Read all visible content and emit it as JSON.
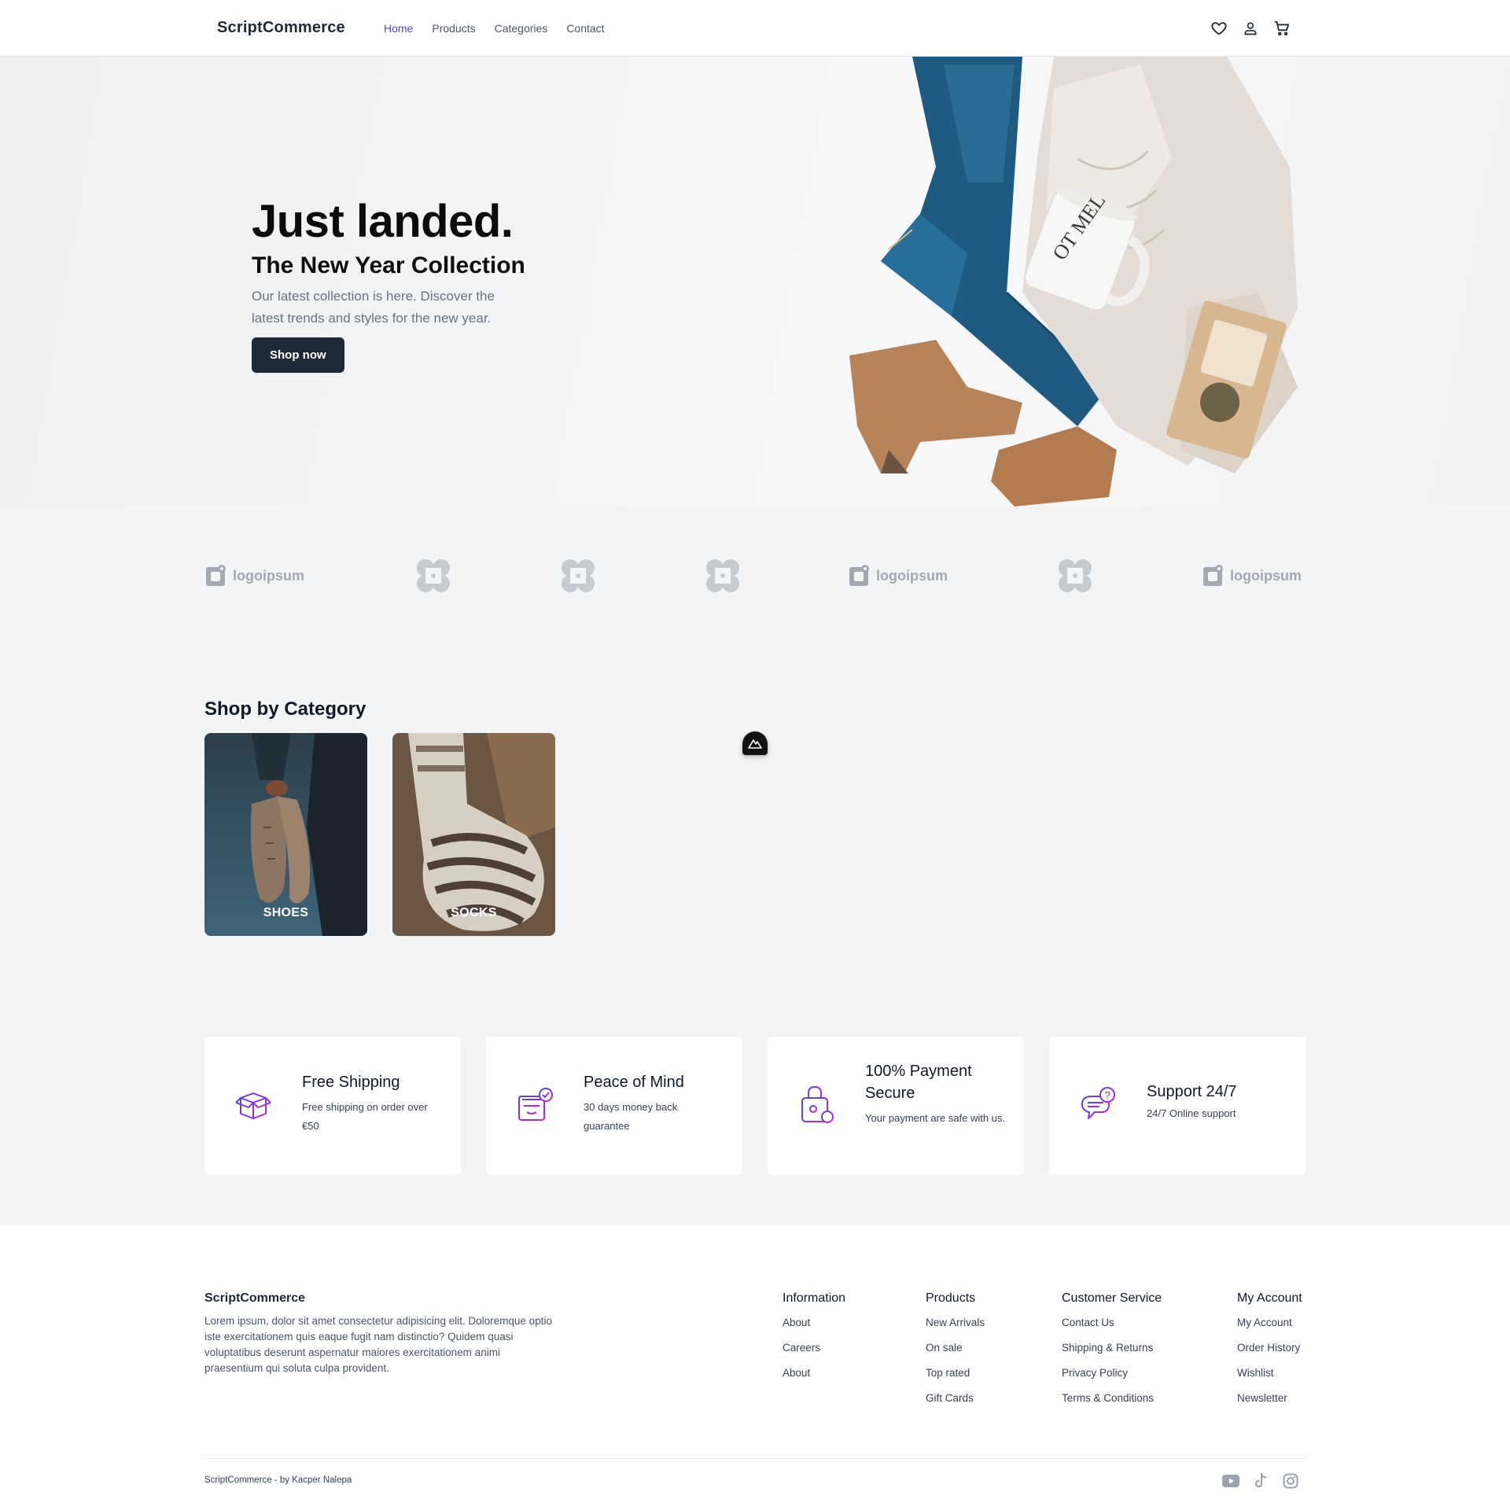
{
  "header": {
    "brand": "ScriptCommerce",
    "nav": [
      "Home",
      "Products",
      "Categories",
      "Contact"
    ],
    "active_nav": "Home",
    "icons": [
      "heart-icon",
      "user-icon",
      "cart-icon"
    ]
  },
  "hero": {
    "title": "Just landed.",
    "subtitle": "The New Year Collection",
    "description": "Our latest collection is here. Discover the latest trends and styles for the new year.",
    "button": "Shop now"
  },
  "logos": [
    {
      "type": "wordmark",
      "text": "logoipsum"
    },
    {
      "type": "mark"
    },
    {
      "type": "mark"
    },
    {
      "type": "mark"
    },
    {
      "type": "wordmark",
      "text": "logoipsum"
    },
    {
      "type": "mark"
    },
    {
      "type": "wordmark",
      "text": "logoipsum"
    }
  ],
  "categories": {
    "title": "Shop by Category",
    "items": [
      {
        "label": "SHOES"
      },
      {
        "label": "SOCKS"
      }
    ]
  },
  "features": [
    {
      "title": "Free Shipping",
      "description": "Free shipping on order over €50",
      "icon": "box-icon"
    },
    {
      "title": "Peace of Mind",
      "description": "30 days money back guarantee",
      "icon": "money-back-icon"
    },
    {
      "title": "100% Payment Secure",
      "description": "Your payment are safe with us.",
      "icon": "secure-payment-icon"
    },
    {
      "title": "Support 24/7",
      "description": "24/7 Online support",
      "icon": "support-chat-icon"
    }
  ],
  "footer": {
    "brand": "ScriptCommerce",
    "description": "Lorem ipsum, dolor sit amet consectetur adipisicing elit. Doloremque optio iste exercitationem quis eaque fugit nam distinctio? Quidem quasi voluptatibus deserunt aspernatur maiores exercitationem animi praesentium qui soluta culpa provident.",
    "columns": [
      {
        "title": "Information",
        "links": [
          "About",
          "Careers",
          "About"
        ]
      },
      {
        "title": "Products",
        "links": [
          "New Arrivals",
          "On sale",
          "Top rated",
          "Gift Cards"
        ]
      },
      {
        "title": "Customer Service",
        "links": [
          "Contact Us",
          "Shipping & Returns",
          "Privacy Policy",
          "Terms & Conditions"
        ]
      },
      {
        "title": "My Account",
        "links": [
          "My Account",
          "Order History",
          "Wishlist",
          "Newsletter"
        ]
      }
    ],
    "copyright": "ScriptCommerce - by Kacper Nalepa",
    "social": [
      "youtube-icon",
      "tiktok-icon",
      "instagram-icon"
    ]
  },
  "colors": {
    "accent": "#4f46e5",
    "dark": "#1f2937",
    "page_bg": "#f3f4f6",
    "feature_icon_gradient": [
      "#4f46e5",
      "#c026d3"
    ]
  }
}
